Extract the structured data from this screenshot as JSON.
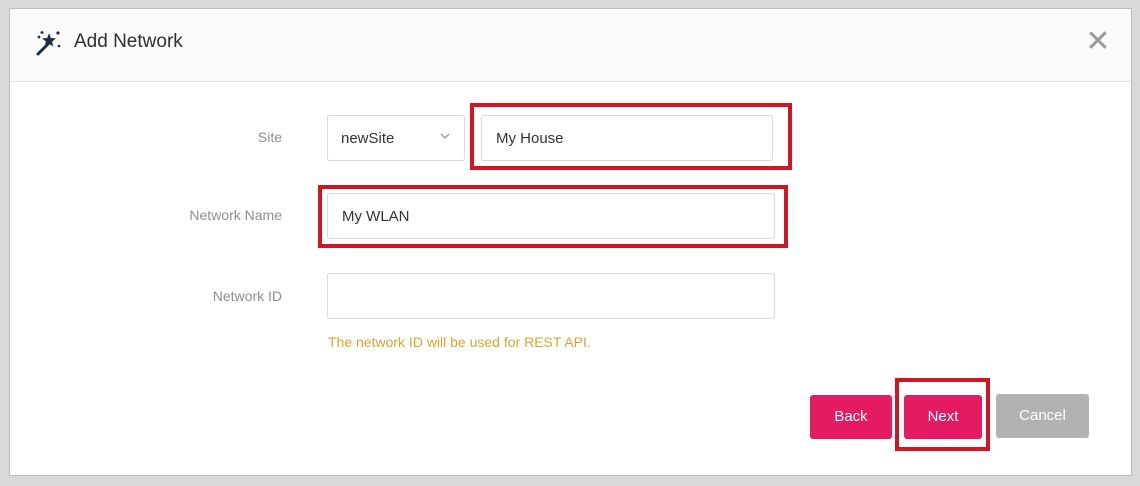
{
  "dialog": {
    "title": "Add Network",
    "title_icon": "magic-wand-icon",
    "close_icon": "close-icon",
    "close_glyph": "✕"
  },
  "form": {
    "site": {
      "label": "Site",
      "select_value": "newSite",
      "name_value": "My House"
    },
    "network_name": {
      "label": "Network Name",
      "value": "My WLAN"
    },
    "network_id": {
      "label": "Network ID",
      "value": "",
      "hint": "The network ID will be used for REST API."
    }
  },
  "buttons": {
    "back": "Back",
    "next": "Next",
    "cancel": "Cancel"
  },
  "colors": {
    "primary": "#e41a63",
    "disabled": "#b2b2b2",
    "hint": "#e0a22e",
    "highlight": "#d01525"
  }
}
